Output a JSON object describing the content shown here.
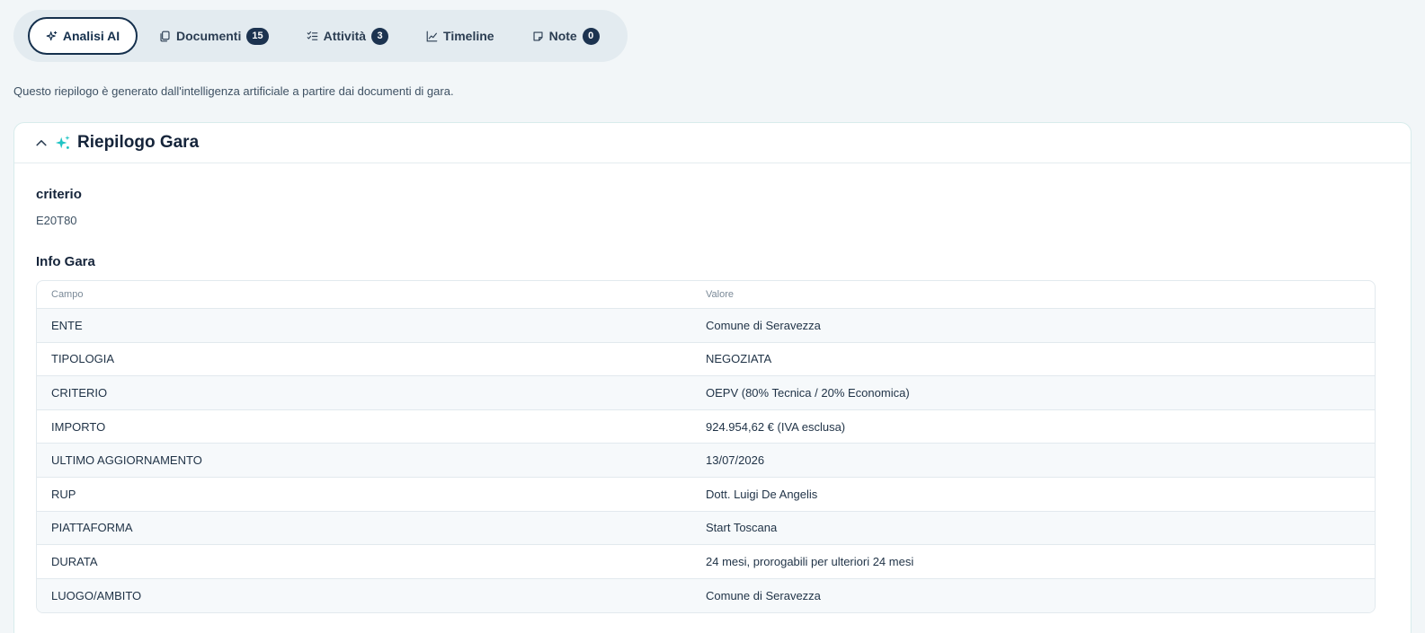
{
  "tabs": [
    {
      "label": "Analisi AI",
      "badge": null,
      "active": true,
      "icon": "sparkle-icon"
    },
    {
      "label": "Documenti",
      "badge": "15",
      "active": false,
      "icon": "documents-icon"
    },
    {
      "label": "Attività",
      "badge": "3",
      "active": false,
      "icon": "checklist-icon"
    },
    {
      "label": "Timeline",
      "badge": null,
      "active": false,
      "icon": "line-chart-icon"
    },
    {
      "label": "Note",
      "badge": "0",
      "active": false,
      "icon": "note-icon"
    }
  ],
  "intro": "Questo riepilogo è generato dall'intelligenza artificiale a partire dai documenti di gara.",
  "card": {
    "title": "Riepilogo Gara",
    "criterio_label": "criterio",
    "criterio_value": "E20T80",
    "info_label": "Info Gara",
    "table": {
      "headers": [
        "Campo",
        "Valore"
      ],
      "rows": [
        [
          "ENTE",
          "Comune di Seravezza"
        ],
        [
          "TIPOLOGIA",
          "NEGOZIATA"
        ],
        [
          "CRITERIO",
          "OEPV (80% Tecnica / 20% Economica)"
        ],
        [
          "IMPORTO",
          "924.954,62 € (IVA esclusa)"
        ],
        [
          "ULTIMO AGGIORNAMENTO",
          "13/07/2026"
        ],
        [
          "RUP",
          "Dott. Luigi De Angelis"
        ],
        [
          "PIATTAFORMA",
          "Start Toscana"
        ],
        [
          "DURATA",
          "24 mesi, prorogabili per ulteriori 24 mesi"
        ],
        [
          "LUOGO/AMBITO",
          "Comune di Seravezza"
        ]
      ]
    }
  },
  "colors": {
    "accent": "#1fc4c4",
    "navy": "#15304d",
    "background": "#f2f6f8"
  }
}
